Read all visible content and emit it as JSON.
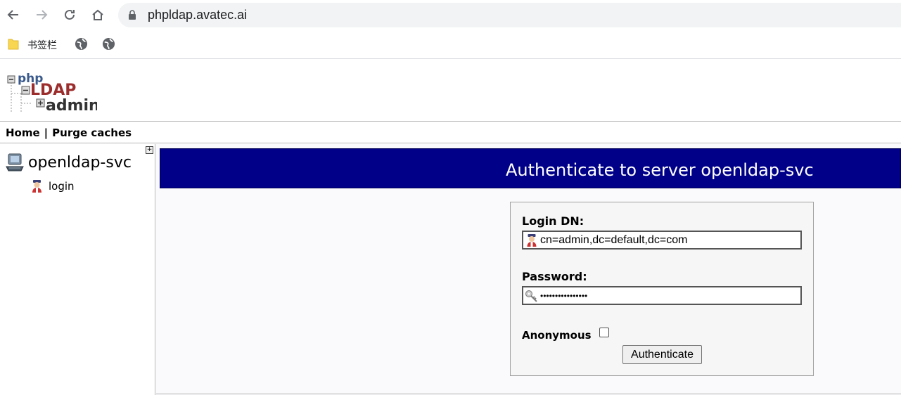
{
  "browser": {
    "url": "phpldap.avatec.ai",
    "bookmarks_label": "书签栏"
  },
  "logo": {
    "line1": "php",
    "line2": "LDAP",
    "line3": "admin"
  },
  "topnav": {
    "home": "Home",
    "separator": "|",
    "purge": "Purge caches"
  },
  "tree": {
    "server_name": "openldap-svc",
    "login_label": "login",
    "toggle": "+"
  },
  "main": {
    "title": "Authenticate to server openldap-svc",
    "login_dn_label": "Login DN:",
    "login_dn_value": "cn=admin,dc=default,dc=com",
    "password_label": "Password:",
    "password_value": "••••••••••••••••",
    "anonymous_label": "Anonymous",
    "authenticate_button": "Authenticate"
  },
  "colors": {
    "title_bar": "#000088",
    "title_text": "#ffffff"
  }
}
